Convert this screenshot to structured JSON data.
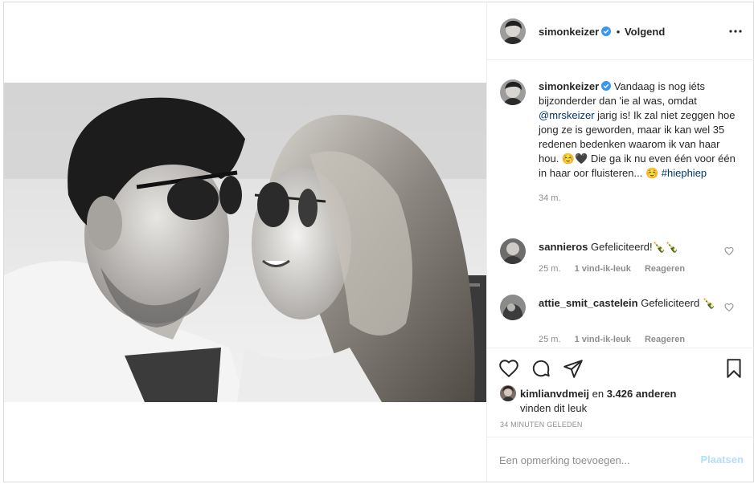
{
  "post": {
    "username": "simonkeizer",
    "follow_separator": "•",
    "follow_status": "Volgend"
  },
  "caption": {
    "username": "simonkeizer",
    "text_before_mention": "Vandaag is nog iéts bijzonderder dan 'ie al was, omdat ",
    "mention": "@mrskeizer",
    "text_after_mention": " jarig is! Ik zal niet zeggen hoe jong ze is geworden, maar ik kan wel 35 redenen bedenken waarom ik van haar hou. ☺️🖤 Die ga ik nu even één voor één in haar oor fluisteren... ☺️ ",
    "hashtag": "#hiephiep",
    "time": "34 m."
  },
  "comments": [
    {
      "username": "sannieros",
      "text": "Gefeliciteerd!🍾🍾",
      "time": "25 m.",
      "likes": "1 vind-ik-leuk",
      "reply": "Reageren"
    },
    {
      "username": "attie_smit_castelein",
      "text": "Gefeliciteerd 🍾",
      "time": "25 m.",
      "likes": "1 vind-ik-leuk",
      "reply": "Reageren"
    }
  ],
  "likes": {
    "user": "kimlianvdmeij",
    "connector": "en",
    "others": "3.426 anderen",
    "suffix": "vinden dit leuk"
  },
  "timestamp": "34 MINUTEN GELEDEN",
  "add_comment": {
    "placeholder": "Een opmerking toevoegen...",
    "post_label": "Plaatsen"
  },
  "icons": {
    "verified": "verified-badge-icon",
    "more": "more-options-icon",
    "like": "heart-icon",
    "comment": "comment-icon",
    "share": "share-icon",
    "save": "bookmark-icon"
  },
  "colors": {
    "verified_blue": "#3897f0",
    "link": "#00376b",
    "muted": "#8e8e8e",
    "border": "#dbdbdb",
    "post_button_disabled": "#b2dffc"
  }
}
